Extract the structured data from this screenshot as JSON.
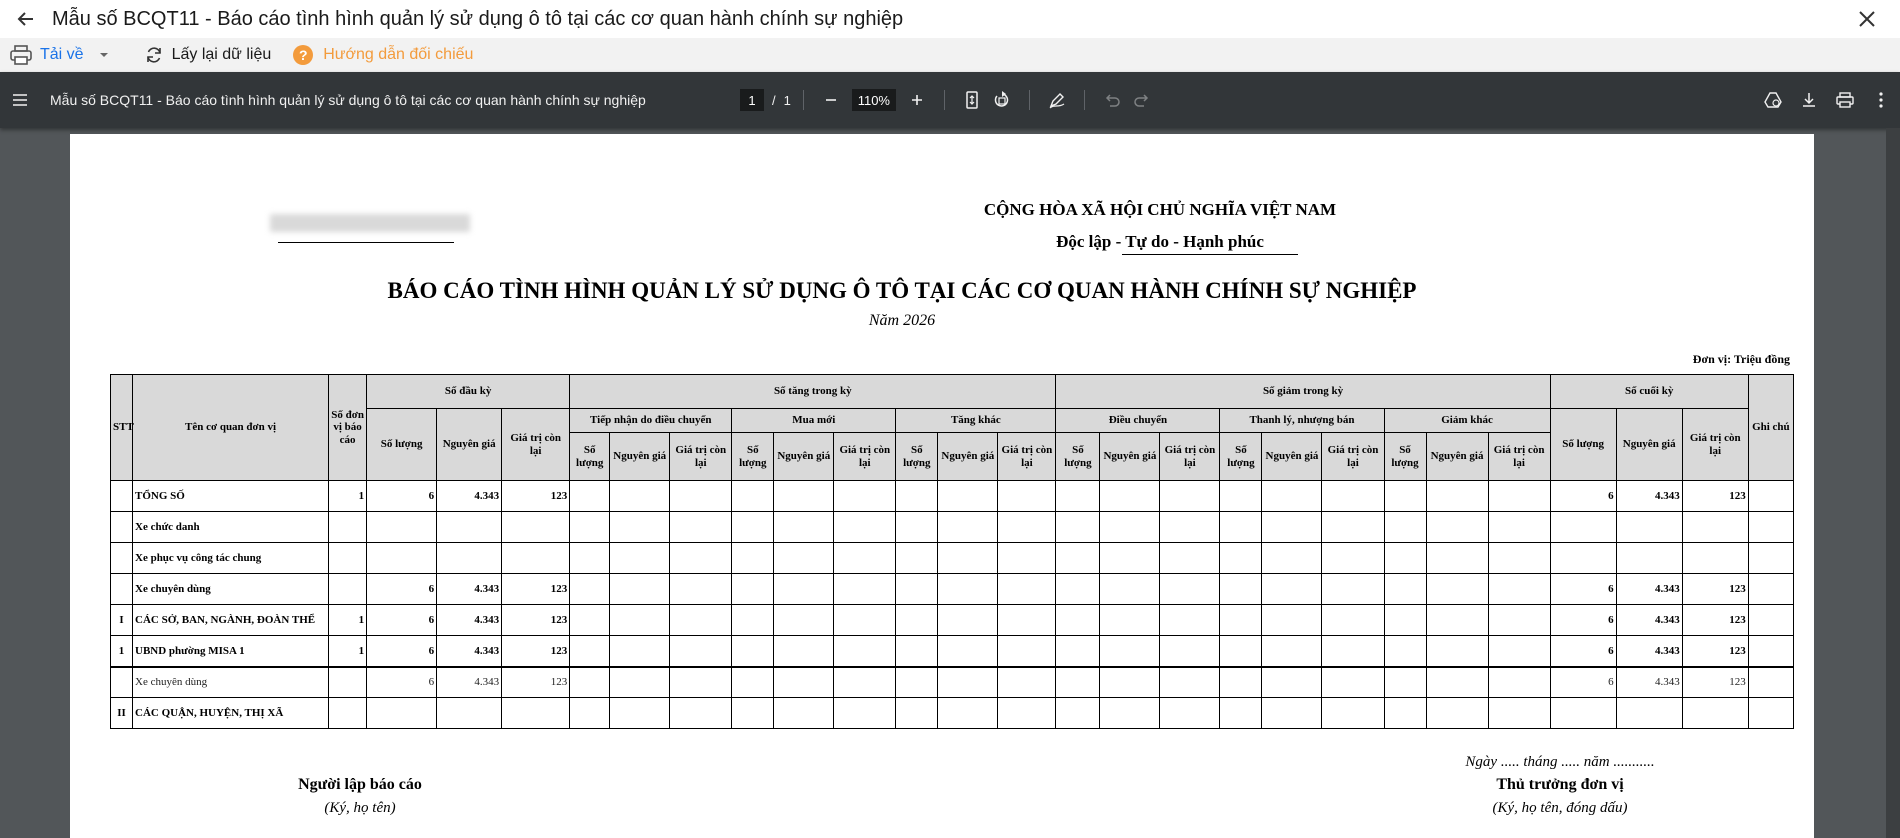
{
  "app": {
    "title": "Mẫu số BCQT11 - Báo cáo tình hình quản lý sử dụng ô tô tại các cơ quan hành chính sự nghiệp"
  },
  "toolbar": {
    "download_label": "Tải về",
    "reload_label": "Lấy lại dữ liệu",
    "guide_label": "Hướng dẫn đối chiếu"
  },
  "pdf": {
    "doc_title": "Mẫu số BCQT11 - Báo cáo tình hình quản lý sử dụng ô tô tại các cơ quan hành chính sự nghiệp",
    "page_current": "1",
    "page_sep": "/",
    "page_total": "1",
    "zoom": "110%"
  },
  "report": {
    "republic": "CỘNG HÒA XÃ HỘI CHỦ NGHĨA VIỆT NAM",
    "motto": "Độc lập - Tự do - Hạnh phúc",
    "title": "BÁO CÁO TÌNH HÌNH QUẢN LÝ SỬ DỤNG Ô TÔ TẠI CÁC CƠ QUAN HÀNH CHÍNH SỰ NGHIỆP",
    "year": "Năm 2026",
    "unit": "Đơn vị: Triệu đồng",
    "headers": {
      "stt": "STT",
      "name": "Tên cơ quan đơn vị",
      "count_units": "Số đơn vị báo cáo",
      "opening": "Số đầu kỳ",
      "increase": "Số tăng trong kỳ",
      "decrease": "Số giảm trong kỳ",
      "closing": "Số cuối kỳ",
      "note": "Ghi chú",
      "transfer_in": "Tiếp nhận do điều chuyển",
      "new_purchase": "Mua mới",
      "other_increase": "Tăng khác",
      "transfer_out": "Điều chuyển",
      "liquidation": "Thanh lý, nhượng bán",
      "other_decrease": "Giảm khác",
      "qty": "Số lượng",
      "orig": "Nguyên giá",
      "remain": "Giá trị còn lại"
    },
    "rows": [
      {
        "stt": "",
        "name": "TỔNG SỐ",
        "units": "1",
        "oq": "6",
        "oo": "4.343",
        "or": "123",
        "cq": "6",
        "co": "4.343",
        "cr": "123"
      },
      {
        "stt": "",
        "name": "Xe chức danh",
        "units": "",
        "oq": "",
        "oo": "",
        "or": "",
        "cq": "",
        "co": "",
        "cr": ""
      },
      {
        "stt": "",
        "name": "Xe phục vụ công tác chung",
        "units": "",
        "oq": "",
        "oo": "",
        "or": "",
        "cq": "",
        "co": "",
        "cr": ""
      },
      {
        "stt": "",
        "name": "Xe chuyên dùng",
        "units": "",
        "oq": "6",
        "oo": "4.343",
        "or": "123",
        "cq": "6",
        "co": "4.343",
        "cr": "123"
      },
      {
        "stt": "I",
        "name": "CÁC SỞ, BAN, NGÀNH, ĐOÀN THỂ",
        "units": "1",
        "oq": "6",
        "oo": "4.343",
        "or": "123",
        "cq": "6",
        "co": "4.343",
        "cr": "123"
      },
      {
        "stt": "1",
        "name": "UBND phường MISA 1",
        "units": "1",
        "oq": "6",
        "oo": "4.343",
        "or": "123",
        "cq": "6",
        "co": "4.343",
        "cr": "123"
      },
      {
        "stt": "",
        "name": "Xe chuyên dùng",
        "units": "",
        "oq": "6",
        "oo": "4.343",
        "or": "123",
        "cq": "6",
        "co": "4.343",
        "cr": "123"
      },
      {
        "stt": "II",
        "name": "CÁC QUẬN, HUYỆN, THỊ XÃ",
        "units": "",
        "oq": "",
        "oo": "",
        "or": "",
        "cq": "",
        "co": "",
        "cr": ""
      }
    ],
    "sign_date": "Ngày ..... tháng ..... năm ...........",
    "preparer_title": "Người lập báo cáo",
    "preparer_sub": "(Ký, họ tên)",
    "head_title": "Thủ trưởng đơn vị",
    "head_sub": "(Ký, họ tên, đóng dấu)"
  }
}
